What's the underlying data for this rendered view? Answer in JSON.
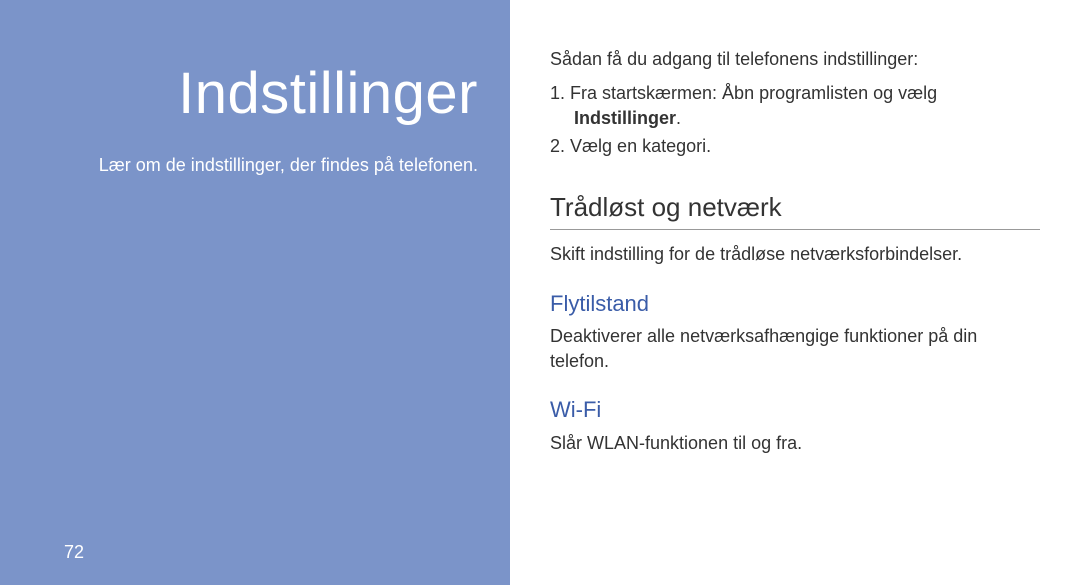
{
  "left": {
    "title": "Indstillinger",
    "subtitle": "Lær om de indstillinger, der findes på telefonen.",
    "page_number": "72"
  },
  "right": {
    "intro": "Sådan få du adgang til telefonens indstillinger:",
    "steps": [
      {
        "num": "1.",
        "text_before": "Fra startskærmen: Åbn programlisten og vælg ",
        "bold": "Indstillinger",
        "text_after": "."
      },
      {
        "num": "2.",
        "text_before": "Vælg en kategori.",
        "bold": "",
        "text_after": ""
      }
    ],
    "section1": {
      "heading": "Trådløst og netværk",
      "text": "Skift indstilling for de trådløse netværksforbindelser."
    },
    "sub1": {
      "heading": "Flytilstand",
      "text": "Deaktiverer alle netværksafhængige funktioner på din telefon."
    },
    "sub2": {
      "heading": "Wi-Fi",
      "text": "Slår WLAN-funktionen til og fra."
    }
  }
}
